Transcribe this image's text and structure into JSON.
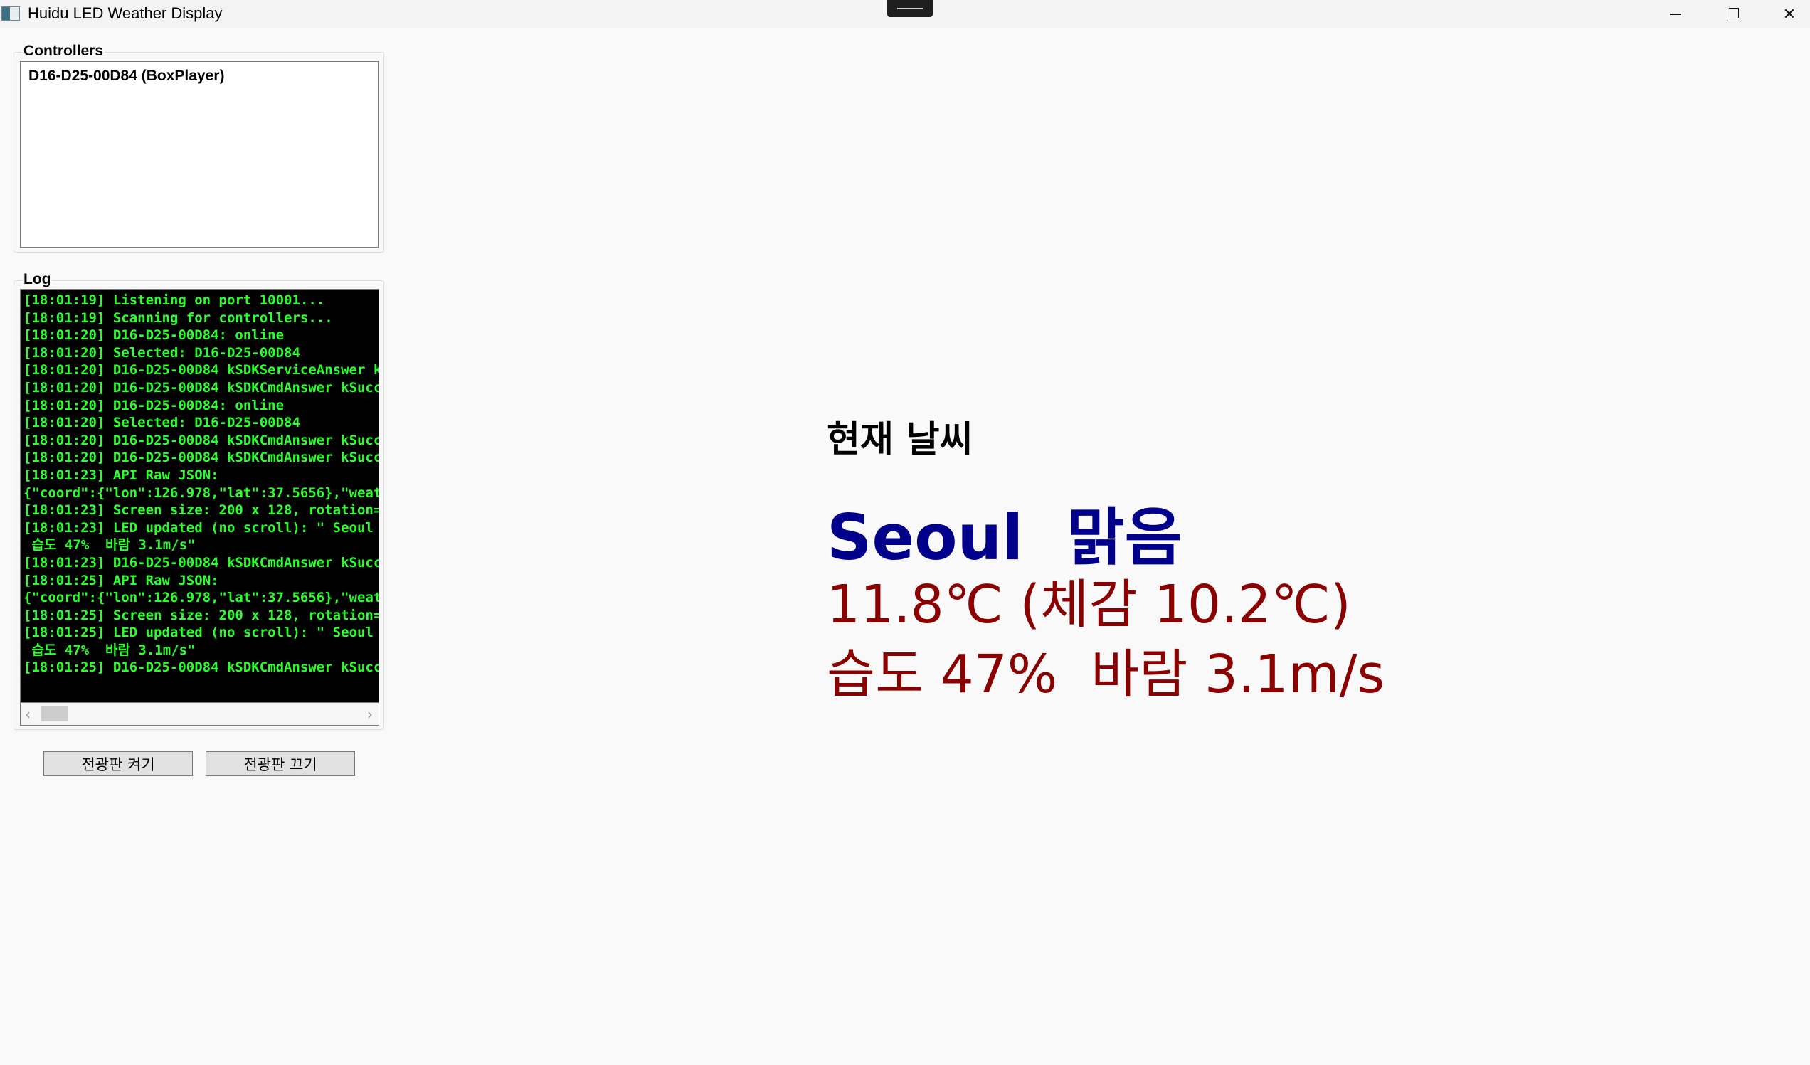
{
  "window": {
    "title": "Huidu LED Weather Display"
  },
  "controllers": {
    "label": "Controllers",
    "items": [
      "D16-D25-00D84 (BoxPlayer)"
    ]
  },
  "log": {
    "label": "Log",
    "lines": [
      "[18:01:19] Listening on port 10001...",
      "[18:01:19] Scanning for controllers...",
      "[18:01:20] D16-D25-00D84: online",
      "[18:01:20] Selected: D16-D25-00D84",
      "[18:01:20] D16-D25-00D84 kSDKServiceAnswer k",
      "[18:01:20] D16-D25-00D84 kSDKCmdAnswer kSucc",
      "[18:01:20] D16-D25-00D84: online",
      "[18:01:20] Selected: D16-D25-00D84",
      "[18:01:20] D16-D25-00D84 kSDKCmdAnswer kSucc",
      "[18:01:20] D16-D25-00D84 kSDKCmdAnswer kSucc",
      "[18:01:23] API Raw JSON:",
      "{\"coord\":{\"lon\":126.978,\"lat\":37.5656},\"weat",
      "[18:01:23] Screen size: 200 x 128, rotation=",
      "[18:01:23] LED updated (no scroll): \" Seoul",
      " 습도 47%  바람 3.1m/s\"",
      "[18:01:23] D16-D25-00D84 kSDKCmdAnswer kSucc",
      "[18:01:25] API Raw JSON:",
      "{\"coord\":{\"lon\":126.978,\"lat\":37.5656},\"weat",
      "[18:01:25] Screen size: 200 x 128, rotation=",
      "[18:01:25] LED updated (no scroll): \" Seoul",
      " 습도 47%  바람 3.1m/s\"",
      "[18:01:25] D16-D25-00D84 kSDKCmdAnswer kSucc"
    ]
  },
  "buttons": {
    "on_label": "전광판 켜기",
    "off_label": "전광판 끄기"
  },
  "weather": {
    "heading": "현재 날씨",
    "city_line": "Seoul  맑음",
    "temp_line": "11.8℃ (체감 10.2℃)",
    "humid_wind_line": "습도 47%  바람 3.1m/s"
  },
  "colors": {
    "log_text": "#2bff2b",
    "city": "#00008b",
    "details": "#8b0000"
  }
}
